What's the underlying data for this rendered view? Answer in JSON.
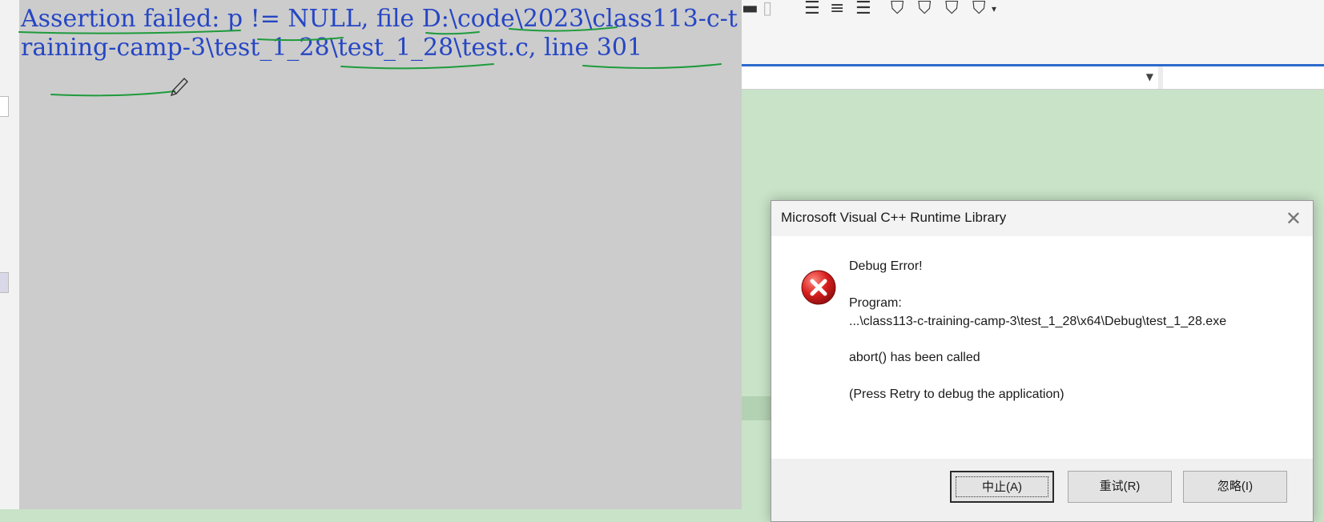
{
  "console": {
    "text": "Assertion failed: p != NULL, file D:\\code\\2023\\class113-c-training-camp-3\\test_1_28\\test_1_28\\test.c, line 301",
    "text_color": "#2646c4",
    "background": "#cccccc"
  },
  "dialog": {
    "title": "Microsoft Visual C++ Runtime Library",
    "heading": "Debug Error!",
    "program_label": "Program:",
    "program_path": "...\\class113-c-training-camp-3\\test_1_28\\x64\\Debug\\test_1_28.exe",
    "message": "abort() has been called",
    "hint": "(Press Retry to debug the application)",
    "buttons": {
      "abort": "中止(A)",
      "retry": "重试(R)",
      "ignore": "忽略(I)"
    }
  },
  "ide": {
    "accent": "#2b6bcc",
    "editor_background": "#c8e3c8"
  },
  "icons": [
    "close-icon",
    "error-icon",
    "pencil-icon",
    "bookmark-icon",
    "indent-icon",
    "dropdown-arrow-icon"
  ],
  "annotation_color": "#1e9b3c"
}
